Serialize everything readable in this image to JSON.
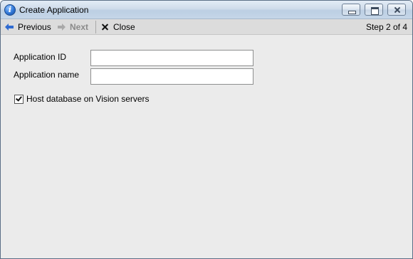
{
  "window": {
    "title": "Create Application",
    "app_icon": "info-icon",
    "controls": [
      "minimize-icon",
      "maximize-icon",
      "close-icon"
    ]
  },
  "toolbar": {
    "previous_label": "Previous",
    "previous_icon": "arrow-left-icon",
    "next_label": "Next",
    "next_icon": "arrow-right-icon",
    "next_enabled": false,
    "close_label": "Close",
    "close_icon": "x-icon",
    "step_text": "Step 2 of 4"
  },
  "form": {
    "application_id_label": "Application ID",
    "application_id_value": "",
    "application_name_label": "Application name",
    "application_name_value": "",
    "host_checkbox_label": "Host database on Vision servers",
    "host_checkbox_checked": true
  },
  "colors": {
    "accent_arrow": "#2f6bd1",
    "disabled_text": "#8a8a8a",
    "panel_bg": "#ebebeb",
    "toolbar_bg": "#dcdcdc"
  }
}
